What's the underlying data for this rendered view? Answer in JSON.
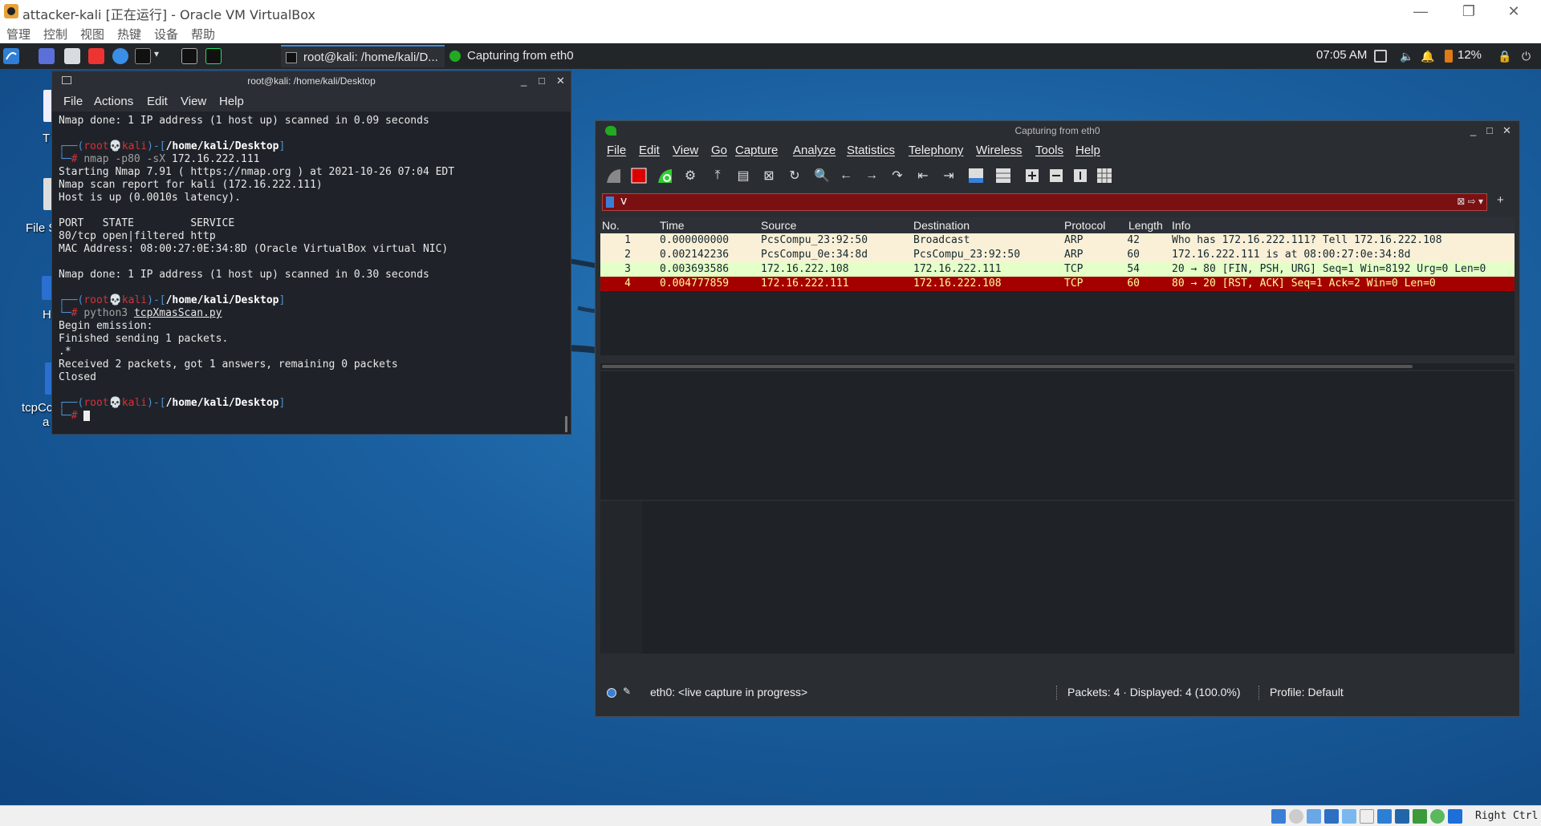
{
  "vbox": {
    "title": "attacker-kali [正在运行] - Oracle VM VirtualBox",
    "menu": [
      "管理",
      "控制",
      "视图",
      "热键",
      "设备",
      "帮助"
    ],
    "host_key": "Right Ctrl"
  },
  "panel": {
    "tasks": [
      {
        "label": "root@kali: /home/kali/D..."
      },
      {
        "label": "Capturing from eth0"
      }
    ],
    "clock": "07:05 AM",
    "battery": "12%"
  },
  "desktop": {
    "icons": [
      "T",
      "File S",
      "H",
      "tcpCc",
      "a"
    ]
  },
  "terminal": {
    "title": "root@kali: /home/kali/Desktop",
    "menu": [
      "File",
      "Actions",
      "Edit",
      "View",
      "Help"
    ],
    "prompt_user": "root",
    "prompt_host": "kali",
    "prompt_path": "/home/kali/Desktop",
    "line_done1": "Nmap done: 1 IP address (1 host up) scanned in 0.09 seconds",
    "cmd1_name": "nmap",
    "cmd1_flags": "-p80 -sX",
    "cmd1_target": "172.16.222.111",
    "out1": [
      "Starting Nmap 7.91 ( https://nmap.org ) at 2021-10-26 07:04 EDT",
      "Nmap scan report for kali (172.16.222.111)",
      "Host is up (0.0010s latency).",
      "",
      "PORT   STATE         SERVICE",
      "80/tcp open|filtered http",
      "MAC Address: 08:00:27:0E:34:8D (Oracle VirtualBox virtual NIC)",
      "",
      "Nmap done: 1 IP address (1 host up) scanned in 0.30 seconds"
    ],
    "cmd2_name": "python3",
    "cmd2_arg": "tcpXmasScan.py",
    "out2": [
      "Begin emission:",
      "Finished sending 1 packets.",
      ".*",
      "Received 2 packets, got 1 answers, remaining 0 packets",
      "Closed"
    ]
  },
  "wireshark": {
    "title": "Capturing from eth0",
    "menu": [
      "File",
      "Edit",
      "View",
      "Go",
      "Capture",
      "Analyze",
      "Statistics",
      "Telephony",
      "Wireless",
      "Tools",
      "Help"
    ],
    "filter_value": "v",
    "columns": [
      "No.",
      "Time",
      "Source",
      "Destination",
      "Protocol",
      "Length",
      "Info"
    ],
    "packets": [
      {
        "no": "1",
        "time": "0.000000000",
        "src": "PcsCompu_23:92:50",
        "dst": "Broadcast",
        "proto": "ARP",
        "len": "42",
        "info": "Who has 172.16.222.111? Tell 172.16.222.108",
        "color": "arp"
      },
      {
        "no": "2",
        "time": "0.002142236",
        "src": "PcsCompu_0e:34:8d",
        "dst": "PcsCompu_23:92:50",
        "proto": "ARP",
        "len": "60",
        "info": "172.16.222.111 is at 08:00:27:0e:34:8d",
        "color": "arp"
      },
      {
        "no": "3",
        "time": "0.003693586",
        "src": "172.16.222.108",
        "dst": "172.16.222.111",
        "proto": "TCP",
        "len": "54",
        "info": "20 → 80 [FIN, PSH, URG] Seq=1 Win=8192 Urg=0 Len=0",
        "color": "tcp-green"
      },
      {
        "no": "4",
        "time": "0.004777859",
        "src": "172.16.222.111",
        "dst": "172.16.222.108",
        "proto": "TCP",
        "len": "60",
        "info": "80 → 20 [RST, ACK] Seq=1 Ack=2 Win=0 Len=0",
        "color": "rst"
      }
    ],
    "status": {
      "interface": "eth0: <live capture in progress>",
      "packets": "Packets: 4 · Displayed: 4 (100.0%)",
      "profile": "Profile: Default"
    }
  },
  "colors": {
    "arp_row": "#faf0d7",
    "tcp_row": "#e4ffc7",
    "rst_row": "#a40000",
    "filter_bad": "#7a1012",
    "kali_blue": "#4f8ecf",
    "kali_red": "#d6313b"
  }
}
